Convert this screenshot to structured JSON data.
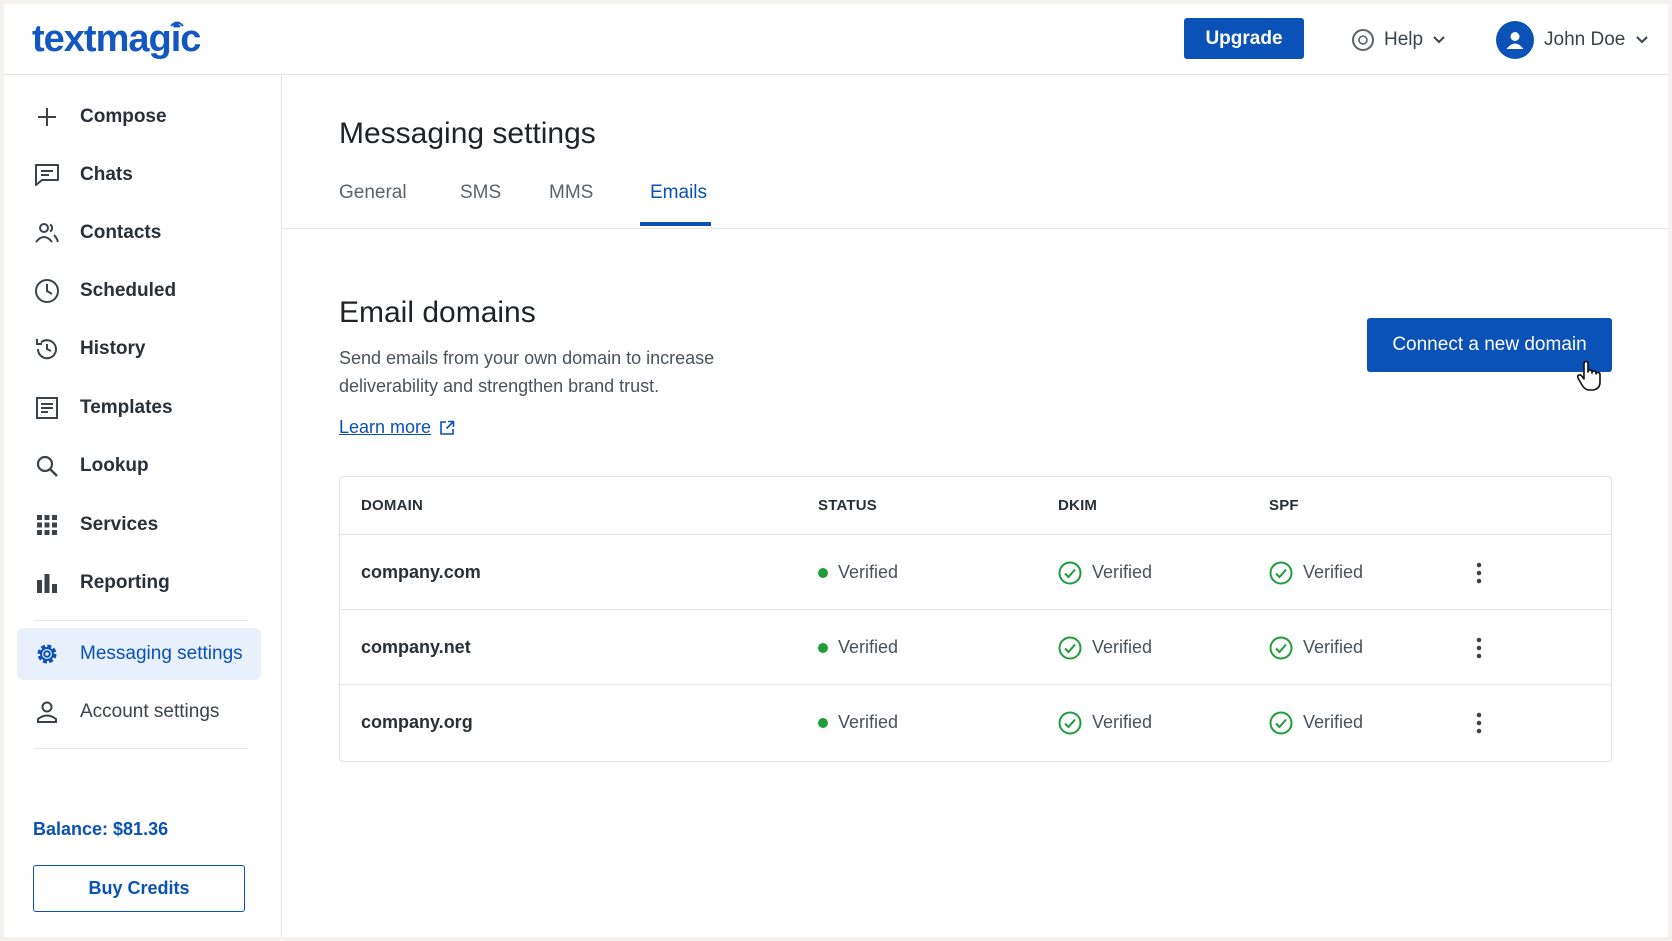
{
  "app": {
    "logo": "textmagic"
  },
  "header": {
    "upgrade_label": "Upgrade",
    "help_label": "Help",
    "user_name": "John Doe"
  },
  "sidebar": {
    "items": [
      {
        "label": "Compose",
        "icon": "plus-icon"
      },
      {
        "label": "Chats",
        "icon": "chat-icon"
      },
      {
        "label": "Contacts",
        "icon": "contacts-icon"
      },
      {
        "label": "Scheduled",
        "icon": "clock-icon"
      },
      {
        "label": "History",
        "icon": "history-icon"
      },
      {
        "label": "Templates",
        "icon": "template-icon"
      },
      {
        "label": "Lookup",
        "icon": "search-icon"
      },
      {
        "label": "Services",
        "icon": "grid-icon"
      },
      {
        "label": "Reporting",
        "icon": "bar-chart-icon"
      },
      {
        "label": "Messaging settings",
        "icon": "gear-icon"
      },
      {
        "label": "Account settings",
        "icon": "person-icon"
      }
    ],
    "balance": "Balance: $81.36",
    "buy_credits_label": "Buy Credits"
  },
  "main": {
    "title": "Messaging settings",
    "tabs": [
      {
        "label": "General"
      },
      {
        "label": "SMS"
      },
      {
        "label": "MMS"
      },
      {
        "label": "Emails",
        "active": true
      }
    ],
    "section": {
      "title": "Email domains",
      "description": "Send emails from your own domain to increase deliverability and strengthen brand trust.",
      "learn_more": "Learn more",
      "connect_label": "Connect a new domain"
    },
    "table": {
      "headers": [
        "DOMAIN",
        "STATUS",
        "DKIM",
        "SPF"
      ],
      "rows": [
        {
          "domain": "company.com",
          "status": "Verified",
          "dkim": "Verified",
          "spf": "Verified"
        },
        {
          "domain": "company.net",
          "status": "Verified",
          "dkim": "Verified",
          "spf": "Verified"
        },
        {
          "domain": "company.org",
          "status": "Verified",
          "dkim": "Verified",
          "spf": "Verified"
        }
      ]
    }
  },
  "colors": {
    "brand": "#0a51b8",
    "success": "#1f9d3a",
    "active_bg": "#e8f0fc"
  }
}
